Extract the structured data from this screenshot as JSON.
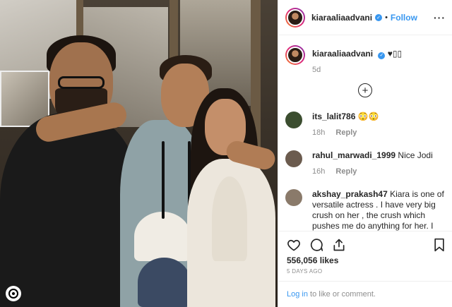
{
  "header": {
    "username": "kiaraaliaadvani",
    "separator": "•",
    "follow_label": "Follow",
    "more_label": "···"
  },
  "caption": {
    "username": "kiaraaliaadvani",
    "text": "♥▯▯",
    "timestamp": "5d"
  },
  "load_more_label": "+",
  "comments": [
    {
      "username": "its_lalit786",
      "text": "😳😳",
      "time": "18h",
      "reply": "Reply",
      "avatar_color": "#3b4d2f"
    },
    {
      "username": "rahul_marwadi_1999",
      "text": "Nice Jodi",
      "time": "16h",
      "reply": "Reply",
      "avatar_color": "#6b5b4e"
    },
    {
      "username": "akshay_prakash47",
      "text": "Kiara is one of versatile actress . I have very big crush on her , the crush which pushes me do anything for her. I wish her current",
      "avatar_color": "#8a7a6a"
    }
  ],
  "actions": {
    "like_icon": "heart-icon",
    "comment_icon": "comment-icon",
    "share_icon": "share-icon",
    "save_icon": "bookmark-icon"
  },
  "likes": "556,056 likes",
  "post_date": "5 DAYS AGO",
  "login": {
    "link": "Log in",
    "rest": " to like or comment."
  },
  "colors": {
    "accent": "#3897f0",
    "muted": "#8e8e8e",
    "text": "#262626"
  }
}
